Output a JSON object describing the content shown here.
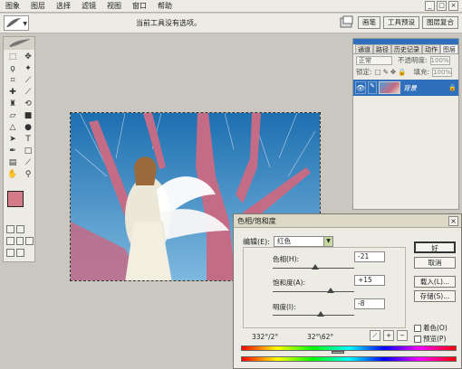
{
  "menubar": {
    "items": [
      "图象",
      "图层",
      "选择",
      "滤镜",
      "视图",
      "窗口",
      "帮助"
    ],
    "win_buttons": [
      "_",
      "□",
      "×"
    ]
  },
  "options": {
    "hint": "当前工具没有选项。",
    "wells": [
      "画笔",
      "工具预设",
      "图层复合"
    ]
  },
  "layers": {
    "tabs": [
      "通道",
      "路径",
      "历史记录",
      "动作",
      "图层"
    ],
    "blend_mode": "正常",
    "opacity_label": "不透明度:",
    "opacity_value": "100%",
    "lock_label": "锁定:",
    "fill_label": "填充:",
    "fill_value": "100%",
    "background_layer": "背景"
  },
  "hue_dialog": {
    "title": "色相/饱和度",
    "close": "×",
    "edit_label": "编辑(E):",
    "edit_value": "红色",
    "hue_label": "色相(H):",
    "hue_value": "-21",
    "sat_label": "饱和度(A):",
    "sat_value": "+15",
    "light_label": "明度(I):",
    "light_value": "-8",
    "ok": "好",
    "cancel": "取消",
    "load": "载入(L)...",
    "save": "存储(S)...",
    "colorize": "着色(O)",
    "preview": "预览(P)",
    "range_left": "332°/2°",
    "range_right": "32°\\62°"
  },
  "colors": {
    "foreground": "#d57a88",
    "background": "#5da3c9",
    "titlebar": "#2f6fbb"
  }
}
